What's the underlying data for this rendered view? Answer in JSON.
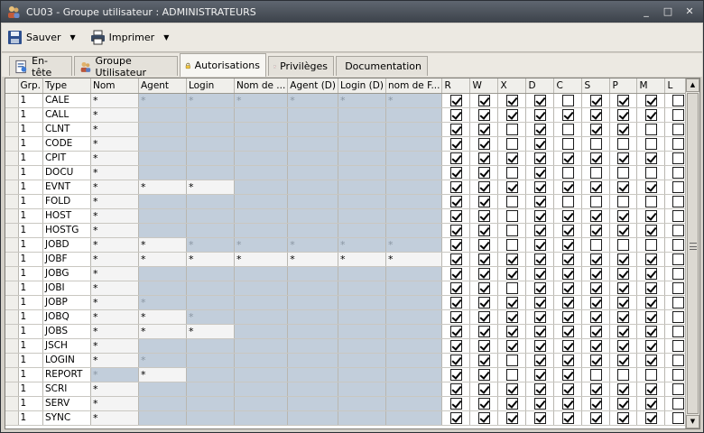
{
  "window": {
    "title": "CU03 - Groupe utilisateur : ADMINISTRATEURS",
    "controls": [
      "_",
      "□",
      "✕"
    ]
  },
  "toolbar": {
    "save_label": "Sauver",
    "print_label": "Imprimer"
  },
  "tabs": [
    {
      "label": "En-tête",
      "icon": "header-icon"
    },
    {
      "label": "Groupe Utilisateur",
      "icon": "users-icon"
    },
    {
      "label": "Autorisations",
      "icon": "lock-icon",
      "active": true
    },
    {
      "label": "Privilèges",
      "icon": "privileges-icon"
    },
    {
      "label": "Documentation",
      "icon": "book-icon"
    }
  ],
  "grid": {
    "columns": [
      "Grp.",
      "Type",
      "Nom",
      "Agent",
      "Login",
      "Nom de ...",
      "Agent (D)",
      "Login (D)",
      "nom de F...",
      "R",
      "W",
      "X",
      "D",
      "C",
      "S",
      "P",
      "M",
      "L"
    ],
    "rows": [
      {
        "grp": "1",
        "type": "CALE",
        "nom": "*",
        "t": [
          "d",
          "d",
          "d",
          "d",
          "d",
          "d"
        ],
        "flags": [
          1,
          1,
          1,
          1,
          0,
          1,
          1,
          1,
          0
        ]
      },
      {
        "grp": "1",
        "type": "CALL",
        "nom": "*",
        "t": [
          "",
          "",
          "",
          "",
          "",
          ""
        ],
        "flags": [
          1,
          1,
          1,
          1,
          1,
          1,
          1,
          1,
          0
        ]
      },
      {
        "grp": "1",
        "type": "CLNT",
        "nom": "*",
        "t": [
          "",
          "",
          "",
          "",
          "",
          ""
        ],
        "flags": [
          1,
          1,
          0,
          1,
          0,
          1,
          1,
          0,
          0
        ]
      },
      {
        "grp": "1",
        "type": "CODE",
        "nom": "*",
        "t": [
          "",
          "",
          "",
          "",
          "",
          ""
        ],
        "flags": [
          1,
          1,
          0,
          1,
          0,
          0,
          0,
          0,
          0
        ]
      },
      {
        "grp": "1",
        "type": "CPIT",
        "nom": "*",
        "t": [
          "",
          "",
          "",
          "",
          "",
          ""
        ],
        "flags": [
          1,
          1,
          1,
          1,
          1,
          1,
          1,
          1,
          0
        ]
      },
      {
        "grp": "1",
        "type": "DOCU",
        "nom": "*",
        "t": [
          "",
          "",
          "",
          "",
          "",
          ""
        ],
        "flags": [
          1,
          1,
          0,
          1,
          0,
          0,
          0,
          0,
          0
        ]
      },
      {
        "grp": "1",
        "type": "EVNT",
        "nom": "*",
        "t": [
          "*",
          "*",
          "",
          "",
          "",
          ""
        ],
        "flags": [
          1,
          1,
          1,
          1,
          1,
          1,
          1,
          1,
          0
        ]
      },
      {
        "grp": "1",
        "type": "FOLD",
        "nom": "*",
        "t": [
          "",
          "",
          "",
          "",
          "",
          ""
        ],
        "flags": [
          1,
          1,
          0,
          1,
          0,
          0,
          0,
          0,
          0
        ]
      },
      {
        "grp": "1",
        "type": "HOST",
        "nom": "*",
        "t": [
          "",
          "",
          "",
          "",
          "",
          ""
        ],
        "flags": [
          1,
          1,
          0,
          1,
          1,
          1,
          1,
          1,
          0
        ]
      },
      {
        "grp": "1",
        "type": "HOSTG",
        "nom": "*",
        "t": [
          "",
          "",
          "",
          "",
          "",
          ""
        ],
        "flags": [
          1,
          1,
          0,
          1,
          1,
          1,
          1,
          1,
          0
        ]
      },
      {
        "grp": "1",
        "type": "JOBD",
        "nom": "*",
        "t": [
          "*",
          "d",
          "d",
          "d",
          "d",
          "d"
        ],
        "flags": [
          1,
          1,
          0,
          1,
          1,
          0,
          0,
          0,
          0
        ]
      },
      {
        "grp": "1",
        "type": "JOBF",
        "nom": "*",
        "t": [
          "*",
          "*",
          "*",
          "*",
          "*",
          "*"
        ],
        "flags": [
          1,
          1,
          1,
          1,
          1,
          1,
          1,
          1,
          0
        ]
      },
      {
        "grp": "1",
        "type": "JOBG",
        "nom": "*",
        "t": [
          "",
          "",
          "",
          "",
          "",
          ""
        ],
        "flags": [
          1,
          1,
          1,
          1,
          1,
          1,
          1,
          1,
          0
        ]
      },
      {
        "grp": "1",
        "type": "JOBI",
        "nom": "*",
        "t": [
          "",
          "",
          "",
          "",
          "",
          ""
        ],
        "flags": [
          1,
          1,
          0,
          1,
          1,
          1,
          1,
          1,
          0
        ]
      },
      {
        "grp": "1",
        "type": "JOBP",
        "nom": "*",
        "t": [
          "d",
          "",
          "",
          "",
          "",
          ""
        ],
        "flags": [
          1,
          1,
          1,
          1,
          1,
          1,
          1,
          1,
          0
        ]
      },
      {
        "grp": "1",
        "type": "JOBQ",
        "nom": "*",
        "t": [
          "*",
          "d",
          "",
          "",
          "",
          ""
        ],
        "flags": [
          1,
          1,
          1,
          1,
          1,
          1,
          1,
          1,
          0
        ]
      },
      {
        "grp": "1",
        "type": "JOBS",
        "nom": "*",
        "t": [
          "*",
          "*",
          "",
          "",
          "",
          ""
        ],
        "flags": [
          1,
          1,
          1,
          1,
          1,
          1,
          1,
          1,
          0
        ]
      },
      {
        "grp": "1",
        "type": "JSCH",
        "nom": "*",
        "t": [
          "",
          "",
          "",
          "",
          "",
          ""
        ],
        "flags": [
          1,
          1,
          1,
          1,
          1,
          1,
          1,
          1,
          0
        ]
      },
      {
        "grp": "1",
        "type": "LOGIN",
        "nom": "*",
        "t": [
          "d",
          "",
          "",
          "",
          "",
          ""
        ],
        "flags": [
          1,
          1,
          0,
          1,
          1,
          1,
          1,
          1,
          0
        ]
      },
      {
        "grp": "1",
        "type": "REPORT",
        "nom": "d",
        "t": [
          "*",
          "",
          "",
          "",
          "",
          ""
        ],
        "flags": [
          1,
          1,
          0,
          1,
          1,
          0,
          0,
          0,
          0
        ]
      },
      {
        "grp": "1",
        "type": "SCRI",
        "nom": "*",
        "t": [
          "",
          "",
          "",
          "",
          "",
          ""
        ],
        "flags": [
          1,
          1,
          1,
          1,
          1,
          1,
          1,
          1,
          0
        ]
      },
      {
        "grp": "1",
        "type": "SERV",
        "nom": "*",
        "t": [
          "",
          "",
          "",
          "",
          "",
          ""
        ],
        "flags": [
          1,
          1,
          1,
          1,
          1,
          1,
          1,
          1,
          0
        ]
      },
      {
        "grp": "1",
        "type": "SYNC",
        "nom": "*",
        "t": [
          "",
          "",
          "",
          "",
          "",
          ""
        ],
        "flags": [
          1,
          1,
          1,
          1,
          1,
          1,
          1,
          1,
          0
        ]
      }
    ]
  },
  "colors": {
    "disabled_cell": "#c2cedb",
    "editable_cell": "#f4f4f4",
    "titlebar": "#4a5058"
  }
}
